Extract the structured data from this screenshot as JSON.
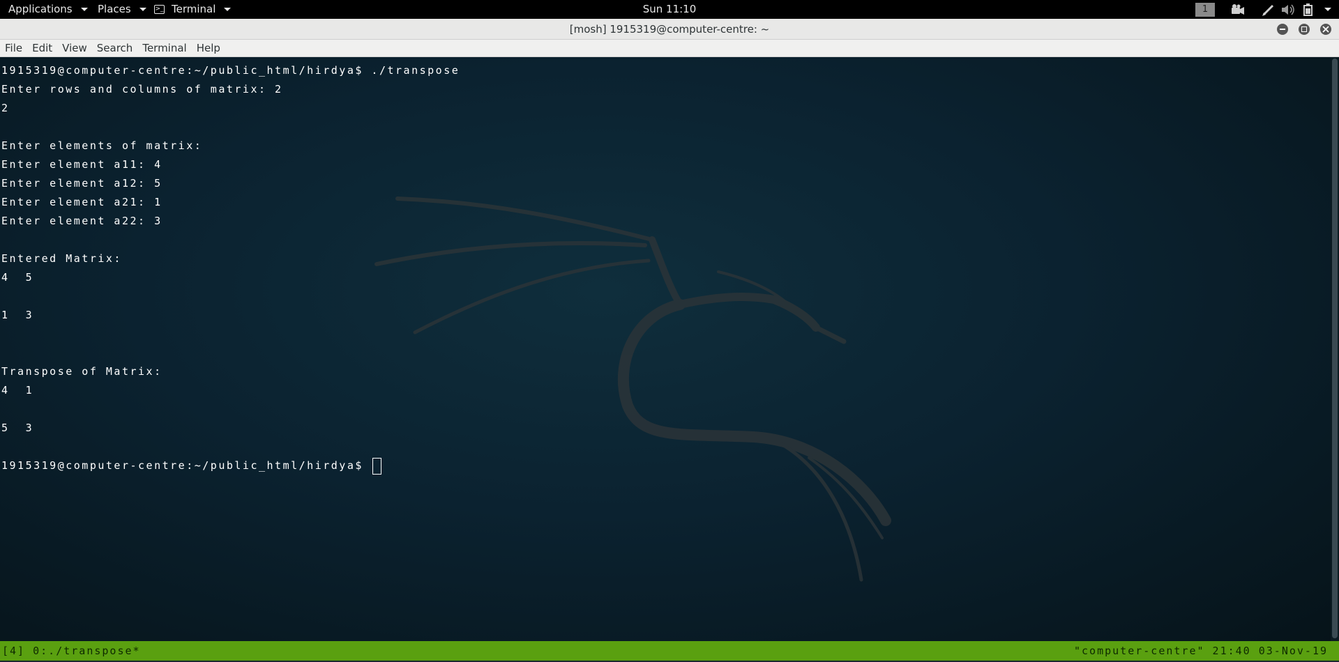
{
  "top_panel": {
    "applications": "Applications",
    "places": "Places",
    "terminal": "Terminal",
    "clock": "Sun 11:10",
    "workspace": "1",
    "tray_icons": [
      "camera-icon",
      "pen-icon",
      "volume-icon",
      "battery-icon"
    ]
  },
  "window": {
    "title": "[mosh] 1915319@computer-centre: ~",
    "menu": [
      "File",
      "Edit",
      "View",
      "Search",
      "Terminal",
      "Help"
    ]
  },
  "terminal": {
    "lines": [
      "1915319@computer-centre:~/public_html/hirdya$ ./transpose",
      "Enter rows and columns of matrix: 2",
      "2",
      "",
      "Enter elements of matrix:",
      "Enter element a11: 4",
      "Enter element a12: 5",
      "Enter element a21: 1",
      "Enter element a22: 3",
      "",
      "Entered Matrix:",
      "4  5",
      "",
      "1  3",
      "",
      "",
      "Transpose of Matrix:",
      "4  1",
      "",
      "5  3",
      ""
    ],
    "prompt": "1915319@computer-centre:~/public_html/hirdya$ "
  },
  "status_bar": {
    "left": "[4] 0:./transpose*",
    "right": "\"computer-centre\" 21:40 03-Nov-19"
  },
  "colors": {
    "status_bar_bg": "#5aa010",
    "terminal_bg": "#0b2230",
    "terminal_fg": "#ffffff"
  }
}
